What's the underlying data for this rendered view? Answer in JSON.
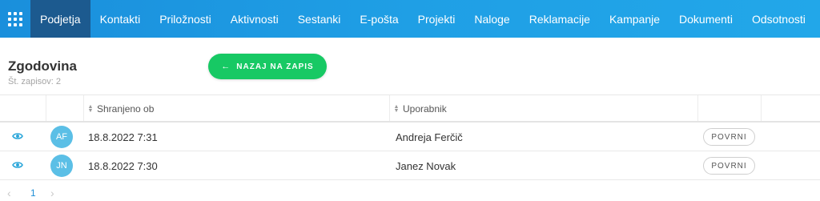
{
  "nav": {
    "apps_icon": "grid-icon",
    "items": [
      {
        "label": "Podjetja",
        "active": true
      },
      {
        "label": "Kontakti"
      },
      {
        "label": "Priložnosti"
      },
      {
        "label": "Aktivnosti"
      },
      {
        "label": "Sestanki"
      },
      {
        "label": "E-pošta"
      },
      {
        "label": "Projekti"
      },
      {
        "label": "Naloge"
      },
      {
        "label": "Reklamacije"
      },
      {
        "label": "Kampanje"
      },
      {
        "label": "Dokumenti"
      },
      {
        "label": "Odsotnosti"
      }
    ]
  },
  "header": {
    "title": "Zgodovina",
    "subtitle": "Št. zapisov: 2",
    "back_button": {
      "icon": "arrow-left-icon",
      "label": "NAZAJ NA ZAPIS"
    }
  },
  "table": {
    "columns": [
      {
        "label": "Shranjeno ob",
        "sortable": true
      },
      {
        "label": "Uporabnik",
        "sortable": true
      }
    ],
    "rows": [
      {
        "initials": "AF",
        "saved_at": "18.8.2022 7:31",
        "user": "Andreja Ferčič",
        "action": "POVRNI"
      },
      {
        "initials": "JN",
        "saved_at": "18.8.2022 7:30",
        "user": "Janez Novak",
        "action": "POVRNI"
      }
    ]
  },
  "pagination": {
    "current": "1",
    "prev_icon": "chevron-left-icon",
    "next_icon": "chevron-right-icon"
  },
  "colors": {
    "nav": "#1f9fe5",
    "nav_active": "#1c5a8f",
    "accent_green": "#17c964",
    "avatar": "#5bbfe6",
    "link": "#1f8fd6"
  }
}
